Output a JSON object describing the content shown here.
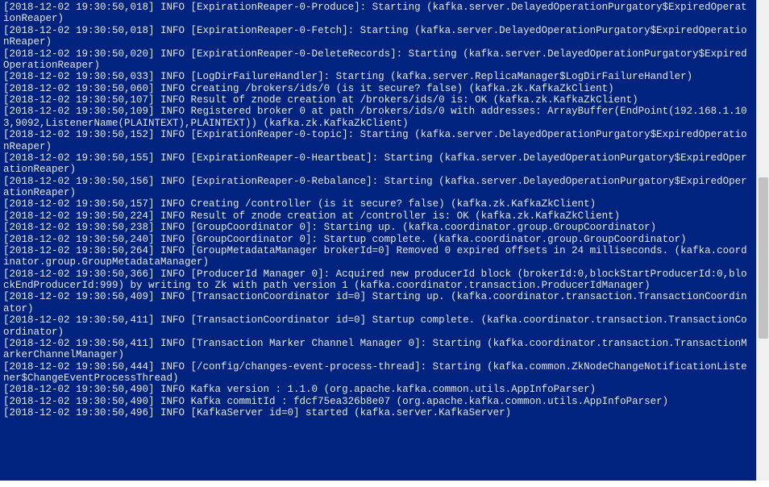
{
  "logs": [
    "[2018-12-02 19:30:50,018] INFO [ExpirationReaper-0-Produce]: Starting (kafka.server.DelayedOperationPurgatory$ExpiredOperationReaper)",
    "[2018-12-02 19:30:50,018] INFO [ExpirationReaper-0-Fetch]: Starting (kafka.server.DelayedOperationPurgatory$ExpiredOperationReaper)",
    "[2018-12-02 19:30:50,020] INFO [ExpirationReaper-0-DeleteRecords]: Starting (kafka.server.DelayedOperationPurgatory$ExpiredOperationReaper)",
    "[2018-12-02 19:30:50,033] INFO [LogDirFailureHandler]: Starting (kafka.server.ReplicaManager$LogDirFailureHandler)",
    "[2018-12-02 19:30:50,060] INFO Creating /brokers/ids/0 (is it secure? false) (kafka.zk.KafkaZkClient)",
    "[2018-12-02 19:30:50,107] INFO Result of znode creation at /brokers/ids/0 is: OK (kafka.zk.KafkaZkClient)",
    "[2018-12-02 19:30:50,109] INFO Registered broker 0 at path /brokers/ids/0 with addresses: ArrayBuffer(EndPoint(192.168.1.103,9092,ListenerName(PLAINTEXT),PLAINTEXT)) (kafka.zk.KafkaZkClient)",
    "[2018-12-02 19:30:50,152] INFO [ExpirationReaper-0-topic]: Starting (kafka.server.DelayedOperationPurgatory$ExpiredOperationReaper)",
    "[2018-12-02 19:30:50,155] INFO [ExpirationReaper-0-Heartbeat]: Starting (kafka.server.DelayedOperationPurgatory$ExpiredOperationReaper)",
    "[2018-12-02 19:30:50,156] INFO [ExpirationReaper-0-Rebalance]: Starting (kafka.server.DelayedOperationPurgatory$ExpiredOperationReaper)",
    "[2018-12-02 19:30:50,157] INFO Creating /controller (is it secure? false) (kafka.zk.KafkaZkClient)",
    "[2018-12-02 19:30:50,224] INFO Result of znode creation at /controller is: OK (kafka.zk.KafkaZkClient)",
    "[2018-12-02 19:30:50,238] INFO [GroupCoordinator 0]: Starting up. (kafka.coordinator.group.GroupCoordinator)",
    "[2018-12-02 19:30:50,240] INFO [GroupCoordinator 0]: Startup complete. (kafka.coordinator.group.GroupCoordinator)",
    "[2018-12-02 19:30:50,264] INFO [GroupMetadataManager brokerId=0] Removed 0 expired offsets in 24 milliseconds. (kafka.coordinator.group.GroupMetadataManager)",
    "[2018-12-02 19:30:50,366] INFO [ProducerId Manager 0]: Acquired new producerId block (brokerId:0,blockStartProducerId:0,blockEndProducerId:999) by writing to Zk with path version 1 (kafka.coordinator.transaction.ProducerIdManager)",
    "[2018-12-02 19:30:50,409] INFO [TransactionCoordinator id=0] Starting up. (kafka.coordinator.transaction.TransactionCoordinator)",
    "[2018-12-02 19:30:50,411] INFO [TransactionCoordinator id=0] Startup complete. (kafka.coordinator.transaction.TransactionCoordinator)",
    "[2018-12-02 19:30:50,411] INFO [Transaction Marker Channel Manager 0]: Starting (kafka.coordinator.transaction.TransactionMarkerChannelManager)",
    "[2018-12-02 19:30:50,444] INFO [/config/changes-event-process-thread]: Starting (kafka.common.ZkNodeChangeNotificationListener$ChangeEventProcessThread)",
    "[2018-12-02 19:30:50,490] INFO Kafka version : 1.1.0 (org.apache.kafka.common.utils.AppInfoParser)",
    "[2018-12-02 19:30:50,490] INFO Kafka commitId : fdcf75ea326b8e07 (org.apache.kafka.common.utils.AppInfoParser)",
    "[2018-12-02 19:30:50,496] INFO [KafkaServer id=0] started (kafka.server.KafkaServer)"
  ]
}
